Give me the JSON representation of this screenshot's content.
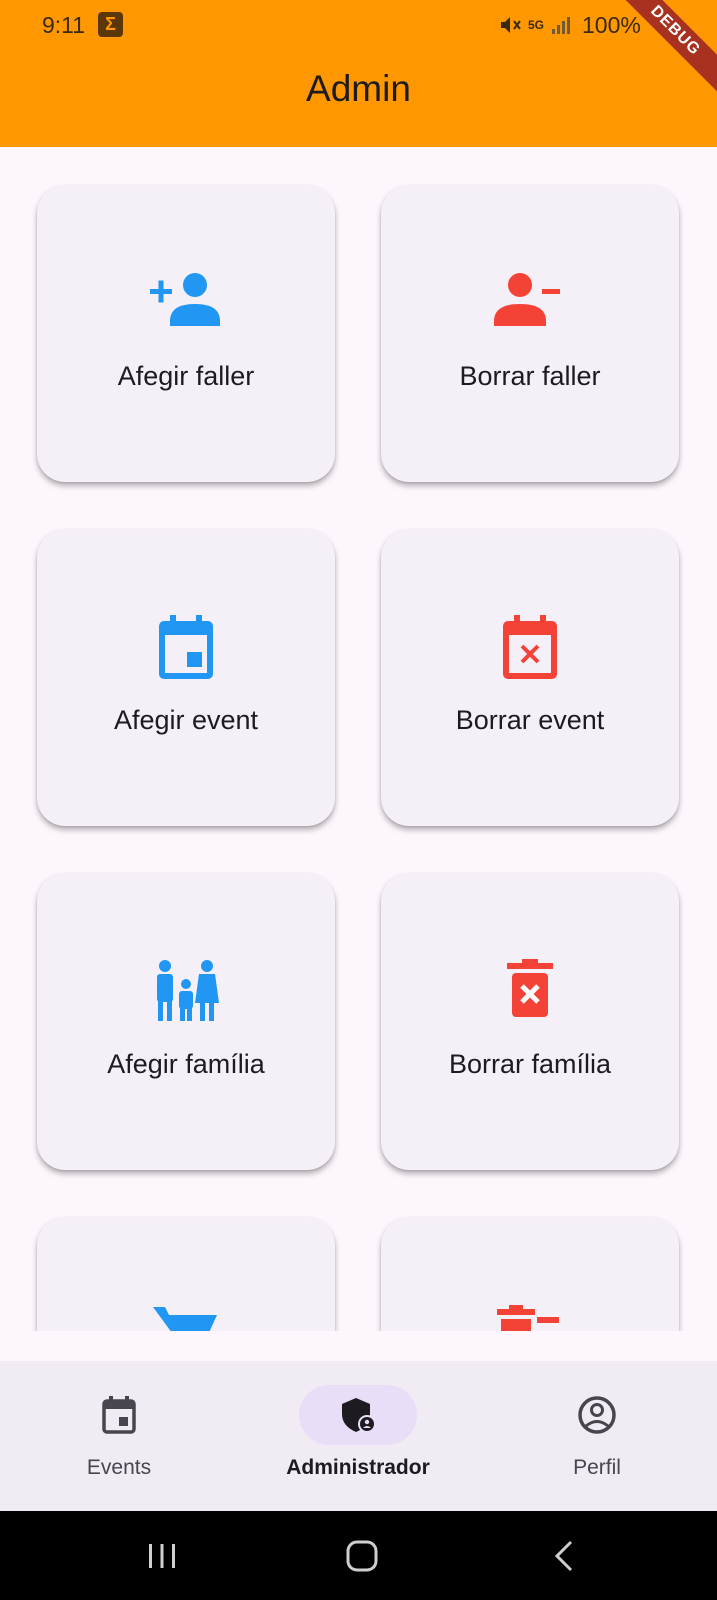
{
  "status_bar": {
    "time": "9:11",
    "notification_icon": "sigma-icon",
    "battery": "100%",
    "network": "5G",
    "debug_banner": "DEBUG"
  },
  "app_bar": {
    "title": "Admin"
  },
  "colors": {
    "app_bar": "#ff9800",
    "add": "#2196f3",
    "remove": "#f44336",
    "card": "#f5f0f7",
    "nav_indicator": "#e8def8"
  },
  "cards": [
    {
      "label": "Afegir faller",
      "icon": "person-add-icon"
    },
    {
      "label": "Borrar faller",
      "icon": "person-remove-icon"
    },
    {
      "label": "Afegir event",
      "icon": "event-icon"
    },
    {
      "label": "Borrar event",
      "icon": "event-busy-icon"
    },
    {
      "label": "Afegir família",
      "icon": "family-icon"
    },
    {
      "label": "Borrar família",
      "icon": "delete-forever-icon"
    },
    {
      "label": "",
      "icon": "shopping-cart-icon"
    },
    {
      "label": "",
      "icon": "remove-shopping-icon"
    }
  ],
  "bottom_nav": {
    "items": [
      {
        "label": "Events",
        "icon": "calendar-icon"
      },
      {
        "label": "Administrador",
        "icon": "admin-shield-icon",
        "active": true
      },
      {
        "label": "Perfil",
        "icon": "account-circle-icon"
      }
    ]
  }
}
